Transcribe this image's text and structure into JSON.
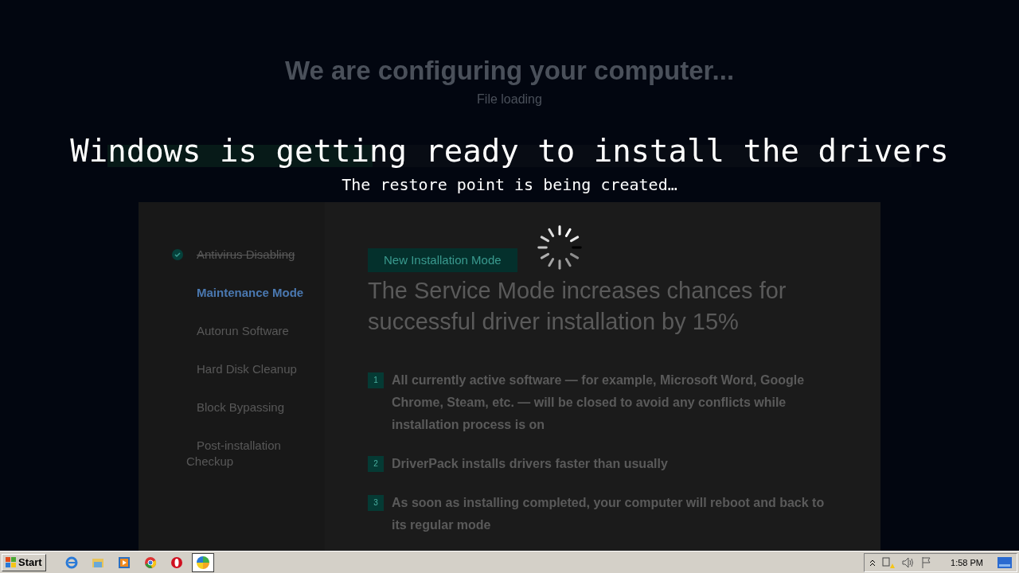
{
  "background_page": {
    "title": "We are configuring your computer...",
    "subtitle": "File loading",
    "progress": {
      "level": 0.33
    }
  },
  "overlay": {
    "title": "Windows is getting ready to install the drivers",
    "subtitle": "The restore point is being created…"
  },
  "sidebar": {
    "steps": [
      {
        "label": "Antivirus Disabling",
        "done": true,
        "selected": false
      },
      {
        "label": "Maintenance Mode",
        "done": false,
        "selected": true
      },
      {
        "label": "Autorun Software",
        "done": false,
        "selected": false
      },
      {
        "label": "Hard Disk Cleanup",
        "done": false,
        "selected": false
      },
      {
        "label": "Block Bypassing",
        "done": false,
        "selected": false
      },
      {
        "label": "Post-installation Checkup",
        "done": false,
        "selected": false
      }
    ]
  },
  "content": {
    "badge": "New Installation Mode",
    "heading": "The Service Mode increases chances for successful driver installation by 15%",
    "points": [
      {
        "number": "1",
        "text": "All currently active software — for example, Microsoft Word, Google Chrome, Steam, etc. — will be closed to avoid any conflicts while installation process is on"
      },
      {
        "number": "2",
        "text": "DriverPack installs drivers faster than usually"
      },
      {
        "number": "3",
        "text": "As soon as installing completed, your computer will reboot and back to its regular mode"
      }
    ]
  },
  "taskbar": {
    "start": "Start",
    "apps": [
      {
        "kind": "ie",
        "selected": false
      },
      {
        "kind": "explorer",
        "selected": false
      },
      {
        "kind": "media",
        "selected": false
      },
      {
        "kind": "chrome",
        "selected": false
      },
      {
        "kind": "opera",
        "selected": false
      },
      {
        "kind": "driverpack",
        "selected": true
      }
    ],
    "clock": "1:58 PM"
  }
}
